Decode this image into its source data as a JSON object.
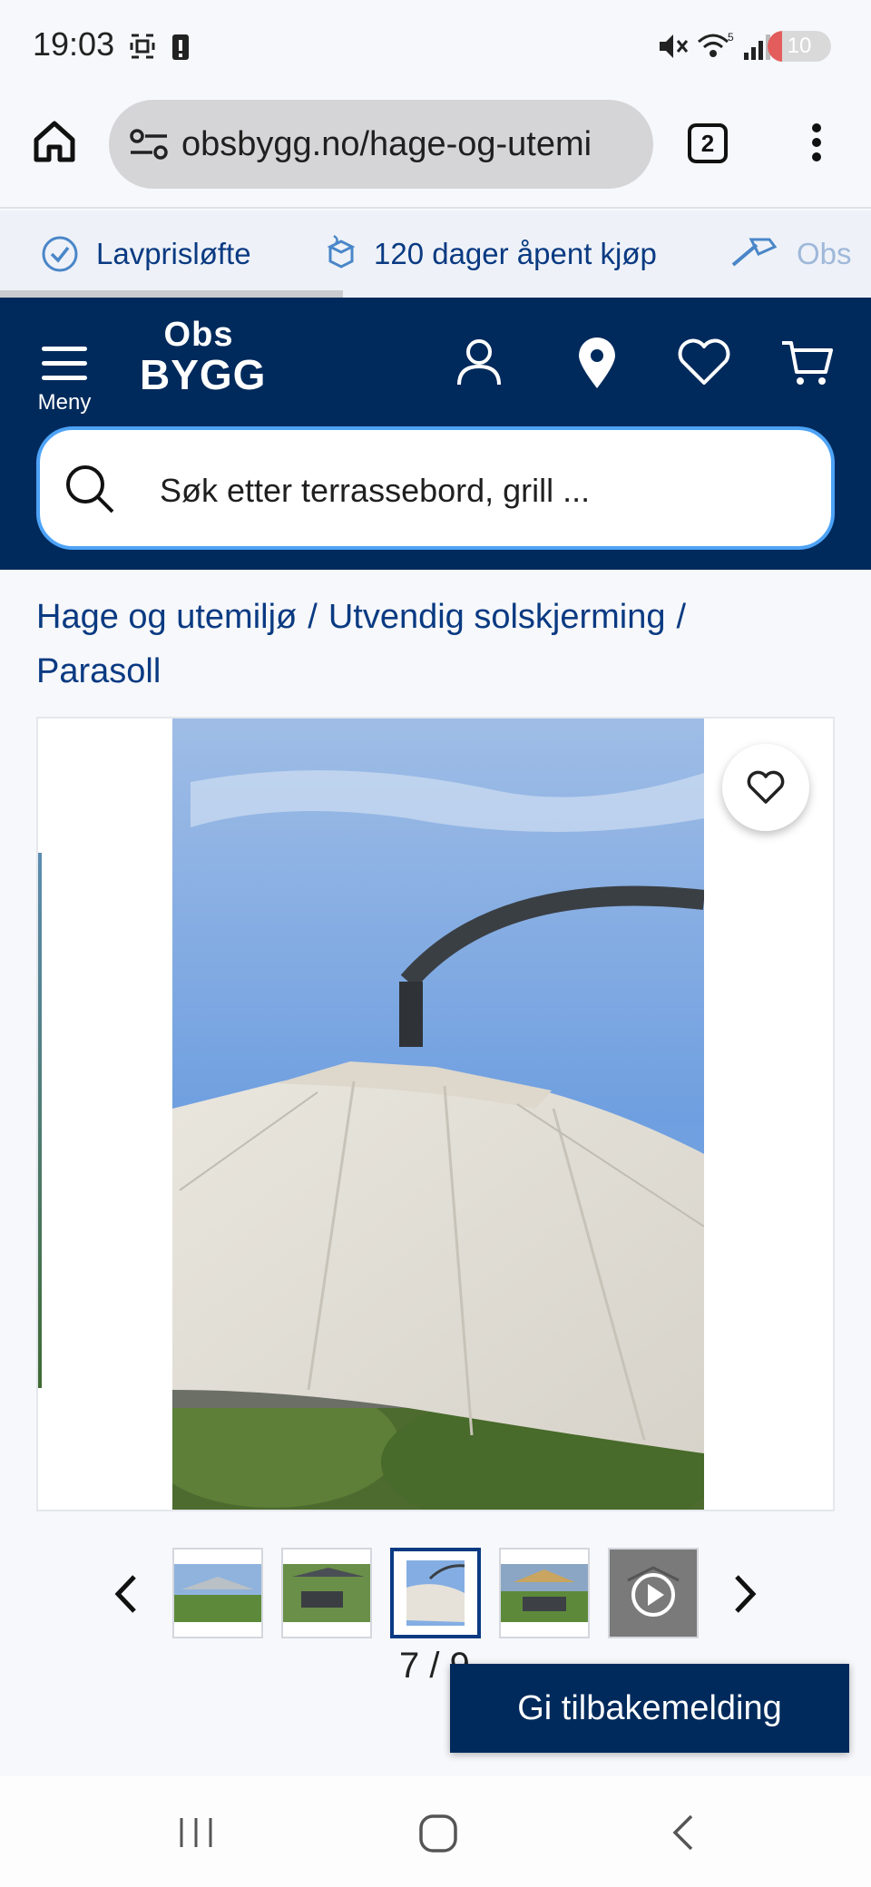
{
  "status_bar": {
    "time": "19:03",
    "battery_level": "10",
    "wifi_label": "5"
  },
  "browser": {
    "url": "obsbygg.no/hage-og-utemi",
    "tab_count": "2"
  },
  "promo": {
    "items": [
      {
        "label": "Lavprisløfte",
        "icon": "check-circle-icon"
      },
      {
        "label": "120 dager åpent kjøp",
        "icon": "box-icon"
      },
      {
        "label": "Obs",
        "icon": "hammer-icon"
      }
    ]
  },
  "header": {
    "menu_label": "Meny",
    "logo_line1": "Obs",
    "logo_line2": "BYGG",
    "search_placeholder": "Søk etter terrassebord, grill ...",
    "icons": [
      "user-icon",
      "location-pin-icon",
      "heart-icon",
      "cart-icon"
    ]
  },
  "breadcrumb": {
    "items": [
      "Hage og utemiljø",
      "Utvendig solskjerming",
      "Parasoll"
    ],
    "separator": "/"
  },
  "gallery": {
    "counter": "7 / 9",
    "thumbnails": 5,
    "active_thumbnail": 3
  },
  "feedback": {
    "label": "Gi tilbakemelding"
  },
  "colors": {
    "brand_navy": "#002a5c",
    "link_blue": "#0a3a82",
    "search_border": "#4da3f7"
  }
}
